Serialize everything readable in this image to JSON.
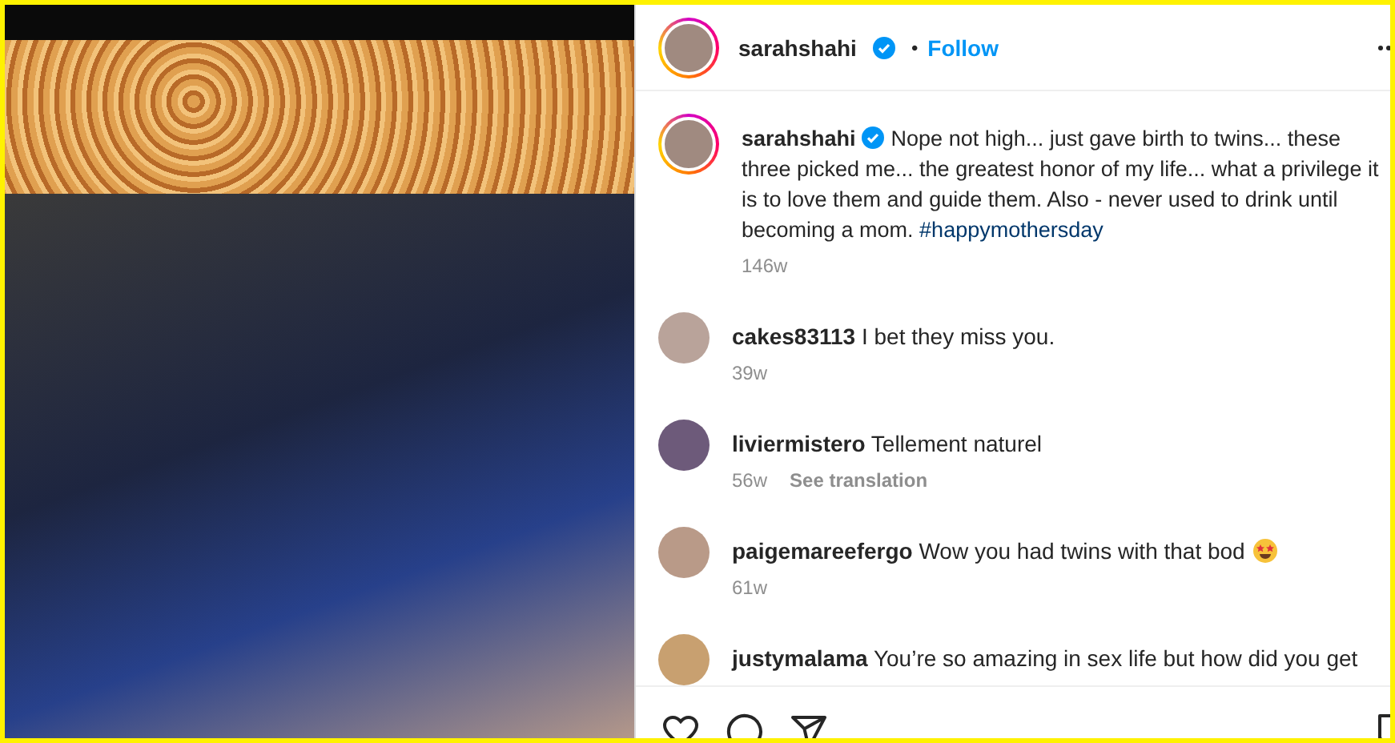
{
  "header": {
    "username": "sarahshahi",
    "verified": true,
    "separator": "•",
    "follow": "Follow"
  },
  "caption": {
    "username": "sarahshahi",
    "verified": true,
    "text": "Nope not high... just gave birth to twins... these three picked me... the greatest honor of my life... what a privilege it is to love them and guide them. Also - never used to drink until becoming a mom. ",
    "hashtag": "#happymothersday",
    "time": "146w"
  },
  "comments": [
    {
      "username": "cakes83113",
      "text": "I bet they miss you.",
      "time": "39w",
      "emoji": false
    },
    {
      "username": "liviermistero",
      "text": "Tellement naturel",
      "time": "56w",
      "translate": "See translation",
      "emoji": false
    },
    {
      "username": "paigemareefergo",
      "text": "Wow you had twins with that bod",
      "time": "61w",
      "emoji": true
    },
    {
      "username": "justymalama",
      "text": "You’re so amazing in sex life but how did you get",
      "emoji": false
    }
  ]
}
